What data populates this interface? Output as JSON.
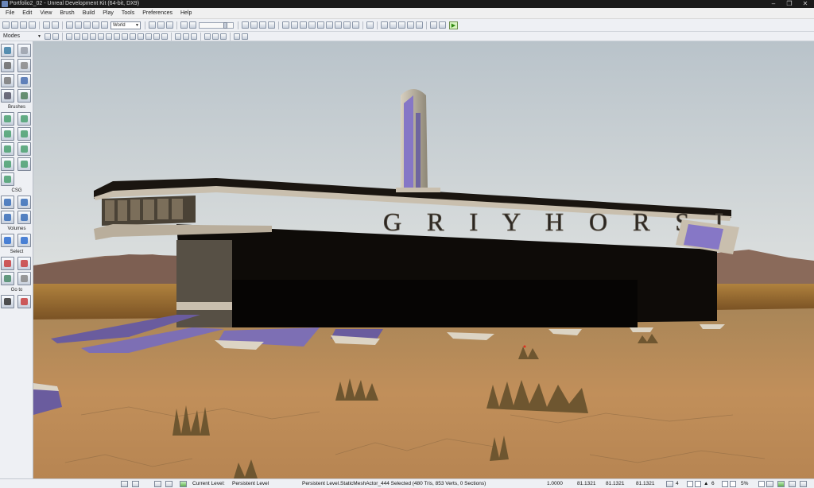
{
  "window": {
    "title": "Portfolio2_02 - Unreal Development Kit (64-bit, DX9)",
    "min": "–",
    "max": "❐",
    "close": "✕"
  },
  "menu": [
    "File",
    "Edit",
    "View",
    "Brush",
    "Build",
    "Play",
    "Tools",
    "Preferences",
    "Help"
  ],
  "toolbar": {
    "coord_system": "World",
    "modes_label": "Modes",
    "play_icon": "play-in-editor-icon"
  },
  "left_panel": {
    "sections": [
      "Brushes",
      "CSG",
      "Volumes",
      "Select",
      "Go to"
    ]
  },
  "scene": {
    "sign_text": "GREYHORSE",
    "sign_text_visible": "G R I Y H O R S I"
  },
  "status": {
    "current_level_label": "Current Level:",
    "current_level_value": "Persistent Level",
    "selection": "Persistent Level.StaticMeshActor_444 Selected (480 Tris, 853 Verts, 0 Sections)",
    "drag_grid": "1.0000",
    "x": "81.1321",
    "y": "81.1321",
    "z": "81.1321",
    "grid_value": "4",
    "rot_value": "6",
    "scale_value": "5%"
  }
}
